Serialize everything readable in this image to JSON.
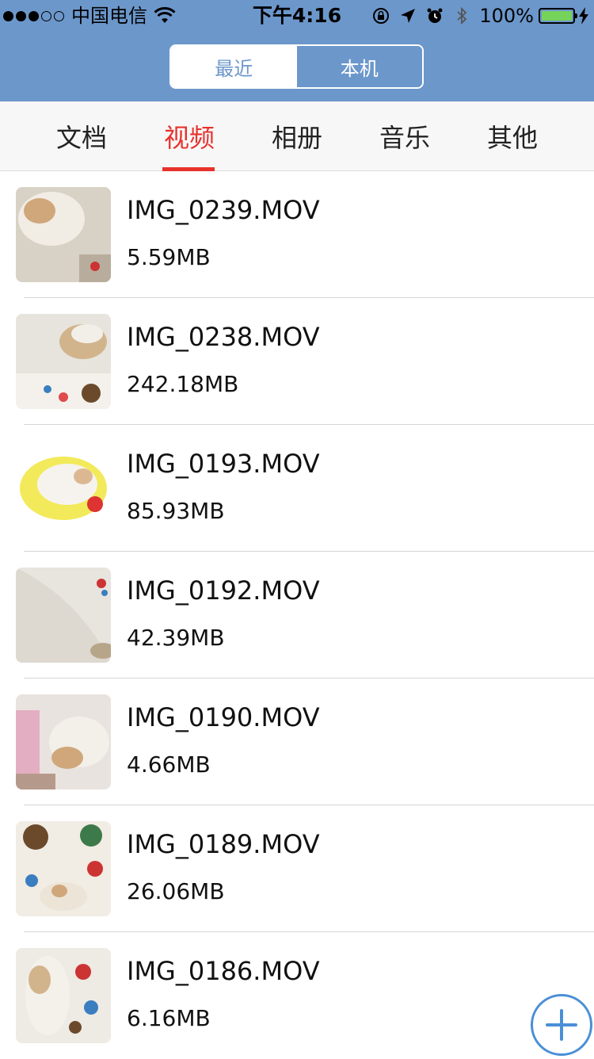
{
  "status_bar": {
    "carrier": "中国电信",
    "time": "下午4:16",
    "battery": "100%",
    "battery_level": 1.0
  },
  "segmented_control": {
    "recent": "最近",
    "local": "本机",
    "selected": "local"
  },
  "tabs": {
    "items": [
      {
        "label": "文档"
      },
      {
        "label": "视频"
      },
      {
        "label": "相册"
      },
      {
        "label": "音乐"
      },
      {
        "label": "其他"
      }
    ],
    "selected": "视频"
  },
  "files": [
    {
      "name": "IMG_0239.MOV",
      "size": "5.59MB"
    },
    {
      "name": "IMG_0238.MOV",
      "size": "242.18MB"
    },
    {
      "name": "IMG_0193.MOV",
      "size": "85.93MB"
    },
    {
      "name": "IMG_0192.MOV",
      "size": "42.39MB"
    },
    {
      "name": "IMG_0190.MOV",
      "size": "4.66MB"
    },
    {
      "name": "IMG_0189.MOV",
      "size": "26.06MB"
    },
    {
      "name": "IMG_0186.MOV",
      "size": "6.16MB"
    }
  ],
  "icons": {
    "wifi": "wifi-icon",
    "orientation_lock": "orientation-lock-icon",
    "location": "location-arrow-icon",
    "alarm": "alarm-clock-icon",
    "bluetooth": "bluetooth-icon",
    "charging": "charging-bolt-icon",
    "add": "plus-icon"
  },
  "colors": {
    "header": "#6c97cb",
    "accent": "#e8322d",
    "fab": "#4a8fd6"
  }
}
